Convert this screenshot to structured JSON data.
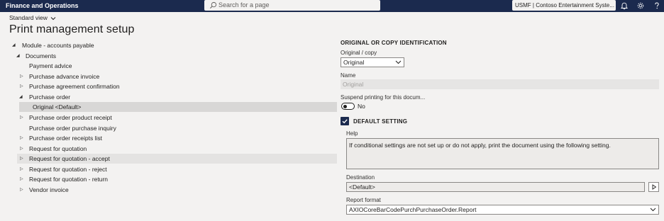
{
  "topbar": {
    "app_title": "Finance and Operations",
    "search_placeholder": "Search for a page",
    "company": "USMF | Contoso Entertainment Syste...",
    "icons": [
      "bell-icon",
      "gear-icon",
      "help-icon"
    ]
  },
  "view": {
    "label": "Standard view"
  },
  "page": {
    "title": "Print management setup"
  },
  "tree": {
    "module": "Module - accounts payable",
    "documents": "Documents",
    "items": [
      {
        "label": "Payment advice",
        "expander": "none"
      },
      {
        "label": "Purchase advance invoice",
        "expander": "collapsed"
      },
      {
        "label": "Purchase agreement confirmation",
        "expander": "collapsed"
      },
      {
        "label": "Purchase order",
        "expander": "expanded"
      },
      {
        "label": "Original <Default>",
        "expander": "none",
        "child": true,
        "selected": true
      },
      {
        "label": "Purchase order product receipt",
        "expander": "collapsed"
      },
      {
        "label": "Purchase order purchase inquiry",
        "expander": "none"
      },
      {
        "label": "Purchase order receipts list",
        "expander": "collapsed"
      },
      {
        "label": "Request for quotation",
        "expander": "collapsed"
      },
      {
        "label": "Request for quotation - accept",
        "expander": "collapsed",
        "hover": true
      },
      {
        "label": "Request for quotation - reject",
        "expander": "collapsed"
      },
      {
        "label": "Request for quotation - return",
        "expander": "collapsed"
      },
      {
        "label": "Vendor invoice",
        "expander": "collapsed"
      }
    ]
  },
  "details": {
    "section_title": "ORIGINAL OR COPY IDENTIFICATION",
    "original_copy_label": "Original / copy",
    "original_copy_value": "Original",
    "name_label": "Name",
    "name_value": "Original",
    "suspend_label": "Suspend printing for this docum...",
    "suspend_value": "No",
    "default_setting_title": "DEFAULT SETTING",
    "default_setting_checked": true,
    "help_label": "Help",
    "help_text": "If conditional settings are not set up or do not apply, print the document using the following setting.",
    "destination_label": "Destination",
    "destination_value": "<Default>",
    "report_format_label": "Report format",
    "report_format_value": "AXIOCoreBarCodePurchPurchaseOrder.Report"
  }
}
